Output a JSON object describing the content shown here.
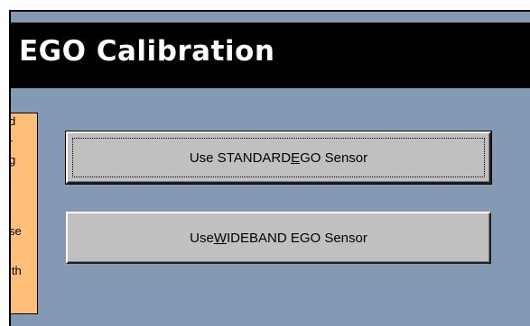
{
  "window": {
    "title": "EGO Calibration"
  },
  "side_panel": {
    "text_fragments": [
      "d",
      "-",
      "g",
      "se",
      "ith"
    ]
  },
  "buttons": [
    {
      "label_before": "Use STANDARD ",
      "label_accel": "E",
      "label_after": "GO Sensor",
      "focused": true
    },
    {
      "label_before": "Use ",
      "label_accel": "W",
      "label_after": "IDEBAND EGO Sensor",
      "focused": false
    }
  ],
  "colors": {
    "background": "#8499b3",
    "title_bar": "#000000",
    "title_text": "#ffffff",
    "side_panel": "#ffbf7a",
    "button_face": "#c0c0c0"
  }
}
